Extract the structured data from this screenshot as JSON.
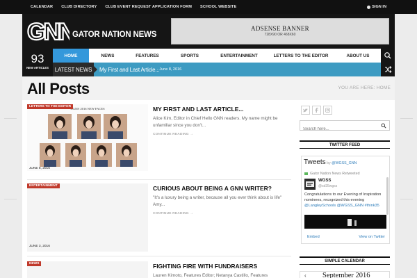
{
  "topbar": {
    "links": [
      "CALENDAR",
      "CLUB DIRECTORY",
      "CLUB EVENT REQUEST APPLICATION FORM",
      "SCHOOL WEBSITE"
    ],
    "signin": "SIGN IN"
  },
  "header": {
    "logo_text": "GNN",
    "site_name": "GATOR NATION NEWS",
    "banner_title": "ADSENSE BANNER",
    "banner_size": "728X90 OR 468X60"
  },
  "counter": {
    "number": "93",
    "label": "NEW ARTICLES"
  },
  "nav": {
    "items": [
      "HOME",
      "NEWS",
      "FEATURES",
      "SPORTS",
      "ENTERTAINMENT",
      "LETTERS TO THE EDITOR",
      "ABOUT US"
    ],
    "active_index": 0
  },
  "ticker": {
    "label": "LATEST NEWS",
    "headline": "My First and Last Article...",
    "date": "- June 8, 2016"
  },
  "page": {
    "title": "All Posts",
    "breadcrumb": "YOU ARE HERE: HOME"
  },
  "posts": [
    {
      "category": "LETTERS TO THE EDITOR",
      "date": "JUNE 8, 2016",
      "title": "MY FIRST AND LAST ARTICLE...",
      "excerpt": "Alice Kim, Editor in Chief Hello GNN readers. My name might be unfamiliar since you don't...",
      "more": "CONTINUE READING →",
      "thumb_heading": "GGNN 2016 NEW FACES"
    },
    {
      "category": "ENTERTAINMENT",
      "date": "JUNE 3, 2016",
      "title": "CURIOUS ABOUT BEING A GNN WRITER?",
      "excerpt": "\"It's a luxury being a writer, because all you ever think about is life\" Amy...",
      "more": "CONTINUE READING →"
    },
    {
      "category": "NEWS",
      "title": "FIGHTING FIRE WITH FUNDRAISERS",
      "excerpt": "Lauren Kimoto, Features Editor; Netanya Castillo, Features"
    }
  ],
  "sidebar": {
    "search_placeholder": "Search here...",
    "twitter_feed_title": "TWITTER FEED",
    "calendar_title": "SIMPLE CALENDAR",
    "calendar_prev": "‹",
    "calendar_month": "September 2016"
  },
  "twitter": {
    "heading": "Tweets",
    "by": "by ",
    "handle_link": "@WGSS_GNN",
    "retweeted": "Gator Nation News Retweeted",
    "author_name": "WGSS",
    "author_handle": "@sd35wgss",
    "text_main": "Congratulations to our Evening of Inspiration nominees, recognized this evening ",
    "text_links": "@LangleySchools @WGSS_GNN #think35",
    "embed": "Embed",
    "view_on": "View on Twitter"
  },
  "colors": {
    "accent_blue": "#3498db",
    "ticker_blue": "#3d9bc2",
    "category_red": "#c0392b",
    "header_dark": "#151515"
  }
}
